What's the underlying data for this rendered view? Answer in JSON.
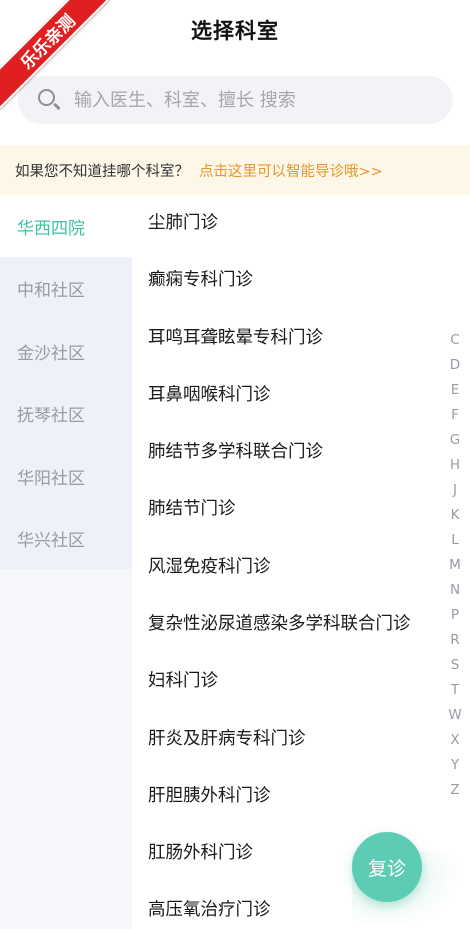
{
  "badge": {
    "text": "乐乐亲测"
  },
  "header": {
    "title": "选择科室"
  },
  "search": {
    "placeholder": "输入医生、科室、擅长 搜索"
  },
  "notice": {
    "text": "如果您不知道挂哪个科室？",
    "link": "点击这里可以智能导诊哦>>"
  },
  "sidebar": {
    "items": [
      {
        "label": "华西四院",
        "active": true
      },
      {
        "label": "中和社区",
        "active": false
      },
      {
        "label": "金沙社区",
        "active": false
      },
      {
        "label": "抚琴社区",
        "active": false
      },
      {
        "label": "华阳社区",
        "active": false
      },
      {
        "label": "华兴社区",
        "active": false
      }
    ]
  },
  "departments": [
    "尘肺门诊",
    "癫痫专科门诊",
    "耳鸣耳聋眩晕专科门诊",
    "耳鼻咽喉科门诊",
    "肺结节多学科联合门诊",
    "肺结节门诊",
    "风湿免疫科门诊",
    "复杂性泌尿道感染多学科联合门诊",
    "妇科门诊",
    "肝炎及肝病专科门诊",
    "肝胆胰外科门诊",
    "肛肠外科门诊",
    "高压氧治疗门诊"
  ],
  "alphabet": [
    "C",
    "D",
    "E",
    "F",
    "G",
    "H",
    "J",
    "K",
    "L",
    "M",
    "N",
    "P",
    "R",
    "S",
    "T",
    "W",
    "X",
    "Y",
    "Z"
  ],
  "fab": {
    "label": "复诊"
  },
  "colors": {
    "accent": "#3fbfa4",
    "link": "#e8962a",
    "badge": "#e02020",
    "fab": "#5ccdb4"
  }
}
